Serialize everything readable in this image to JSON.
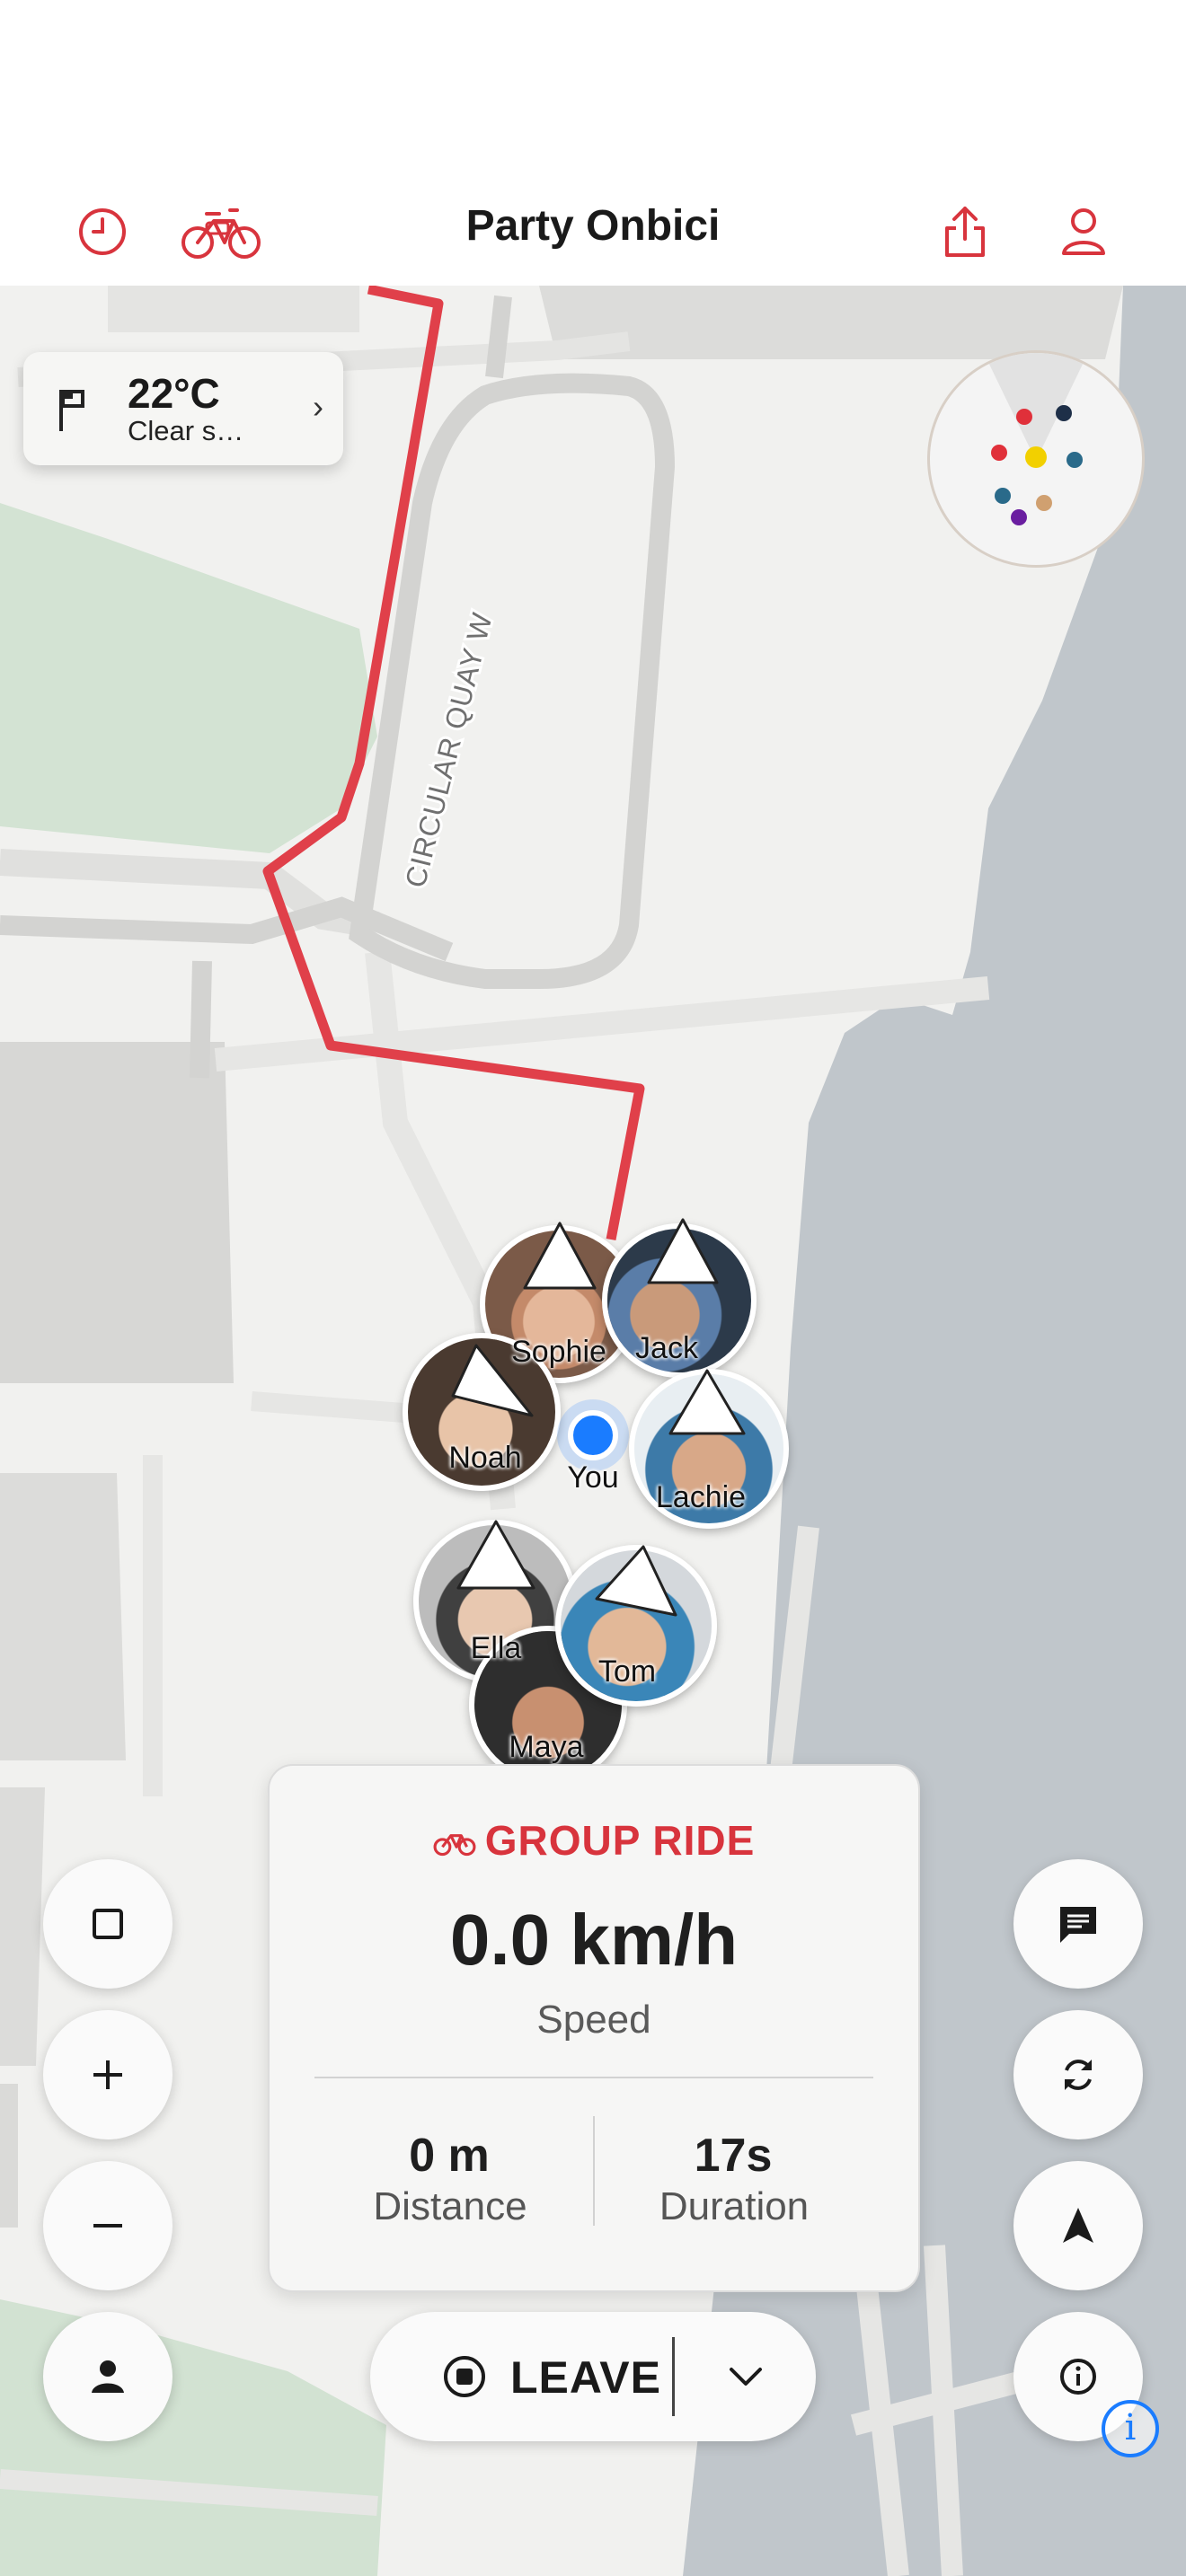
{
  "header": {
    "title": "Party Onbici",
    "history_icon": "clock-icon",
    "bike_icon": "bicycle-icon",
    "share_icon": "share-icon",
    "profile_icon": "person-icon",
    "accent": "#d8343d"
  },
  "weather": {
    "temperature": "22°C",
    "condition": "Clear s…",
    "icon": "flag-icon"
  },
  "map": {
    "street_label": "CIRCULAR QUAY W",
    "route_color": "#e0404a"
  },
  "riders": [
    {
      "name": "Sophie"
    },
    {
      "name": "Jack"
    },
    {
      "name": "Noah"
    },
    {
      "name": "Lachie"
    },
    {
      "name": "Ella"
    },
    {
      "name": "Tom"
    },
    {
      "name": "Maya"
    }
  ],
  "you_label": "You",
  "ride_panel": {
    "mode": "GROUP RIDE",
    "speed": "0.0 km/h",
    "speed_label": "Speed",
    "distance": "0 m",
    "distance_label": "Distance",
    "duration": "17s",
    "duration_label": "Duration"
  },
  "controls": {
    "leave_label": "LEAVE",
    "left": [
      "square-icon",
      "plus-icon",
      "minus-icon",
      "person-icon"
    ],
    "right": [
      "chat-icon",
      "sync-icon",
      "navigation-arrow-icon",
      "info-icon"
    ]
  }
}
